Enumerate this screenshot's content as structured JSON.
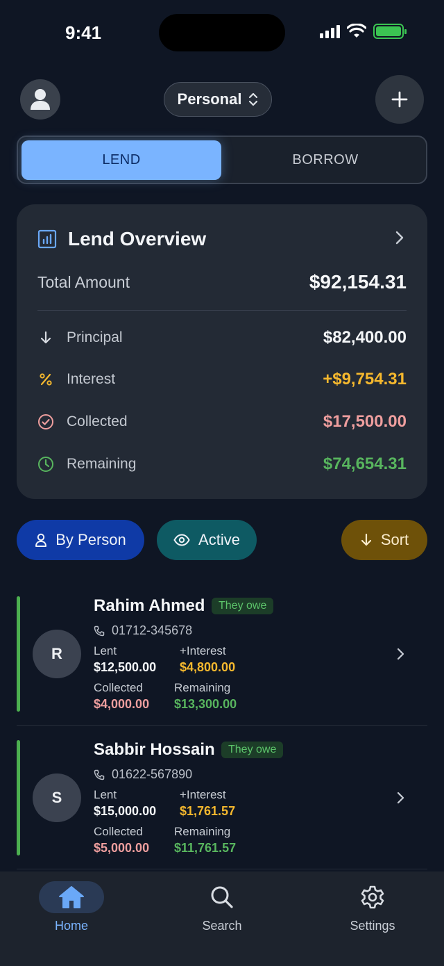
{
  "status": {
    "time": "9:41"
  },
  "header": {
    "mode_label": "Personal"
  },
  "segments": {
    "lend": "LEND",
    "borrow": "BORROW"
  },
  "overview": {
    "title": "Lend Overview",
    "total_label": "Total Amount",
    "total_value": "$92,154.31",
    "rows": [
      {
        "label": "Principal",
        "value": "$82,400.00",
        "color": "#f4f6f8",
        "icon": "arrow-down-icon"
      },
      {
        "label": "Interest",
        "value": "+$9,754.31",
        "color": "#f5b82e",
        "icon": "percent-icon"
      },
      {
        "label": "Collected",
        "value": "$17,500.00",
        "color": "#ee9e9e",
        "icon": "check-circle-icon"
      },
      {
        "label": "Remaining",
        "value": "$74,654.31",
        "color": "#58b55e",
        "icon": "clock-icon"
      }
    ]
  },
  "filters": {
    "by_person": "By Person",
    "active": "Active",
    "sort": "Sort"
  },
  "people": [
    {
      "initial": "R",
      "name": "Rahim Ahmed",
      "badge": "They owe",
      "phone": "01712-345678",
      "lent_label": "Lent",
      "lent": "$12,500.00",
      "interest_label": "+Interest",
      "interest": "$4,800.00",
      "collected_label": "Collected",
      "collected": "$4,000.00",
      "remaining_label": "Remaining",
      "remaining": "$13,300.00"
    },
    {
      "initial": "S",
      "name": "Sabbir Hossain",
      "badge": "They owe",
      "phone": "01622-567890",
      "lent_label": "Lent",
      "lent": "$15,000.00",
      "interest_label": "+Interest",
      "interest": "$1,761.57",
      "collected_label": "Collected",
      "collected": "$5,000.00",
      "remaining_label": "Remaining",
      "remaining": "$11,761.57"
    }
  ],
  "nav": {
    "home": "Home",
    "search": "Search",
    "settings": "Settings"
  },
  "colors": {
    "accent": "#7ab4ff",
    "gold": "#f5b82e",
    "pink": "#ee9e9e",
    "green": "#58b55e"
  }
}
